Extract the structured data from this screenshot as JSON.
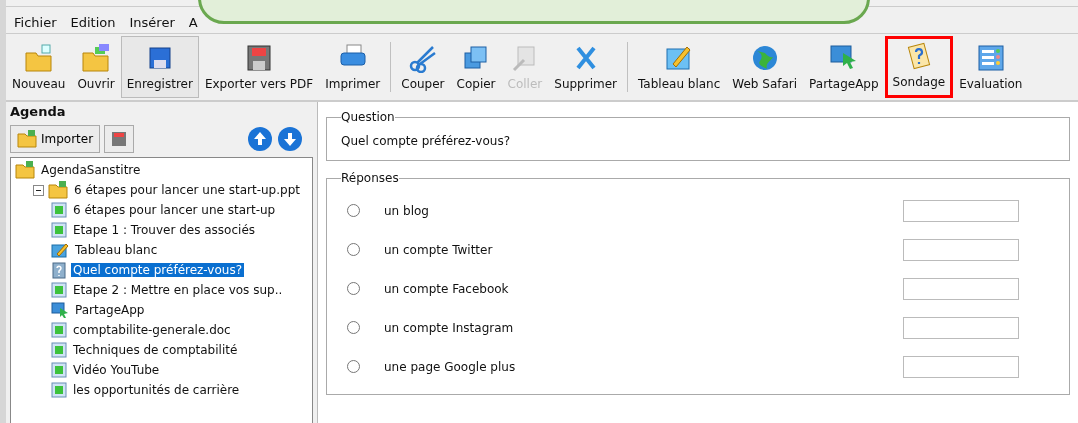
{
  "menu": [
    "Fichier",
    "Edition",
    "Insérer",
    "A"
  ],
  "toolbar": [
    {
      "kind": "button",
      "label": "Nouveau",
      "disabled": false,
      "pressed": false,
      "highlighted": false
    },
    {
      "kind": "button",
      "label": "Ouvrir",
      "disabled": false,
      "pressed": false,
      "highlighted": false
    },
    {
      "kind": "button",
      "label": "Enregistrer",
      "disabled": false,
      "pressed": true,
      "highlighted": false
    },
    {
      "kind": "button",
      "label": "Exporter vers PDF",
      "disabled": false,
      "pressed": false,
      "highlighted": false
    },
    {
      "kind": "button",
      "label": "Imprimer",
      "disabled": false,
      "pressed": false,
      "highlighted": false
    },
    {
      "kind": "separator"
    },
    {
      "kind": "button",
      "label": "Couper",
      "disabled": false,
      "pressed": false,
      "highlighted": false
    },
    {
      "kind": "button",
      "label": "Copier",
      "disabled": false,
      "pressed": false,
      "highlighted": false
    },
    {
      "kind": "button",
      "label": "Coller",
      "disabled": true,
      "pressed": false,
      "highlighted": false
    },
    {
      "kind": "button",
      "label": "Supprimer",
      "disabled": false,
      "pressed": false,
      "highlighted": false
    },
    {
      "kind": "separator"
    },
    {
      "kind": "button",
      "label": "Tableau blanc",
      "disabled": false,
      "pressed": false,
      "highlighted": false
    },
    {
      "kind": "button",
      "label": "Web Safari",
      "disabled": false,
      "pressed": false,
      "highlighted": false
    },
    {
      "kind": "button",
      "label": "PartageApp",
      "disabled": false,
      "pressed": false,
      "highlighted": false
    },
    {
      "kind": "button",
      "label": "Sondage",
      "disabled": false,
      "pressed": false,
      "highlighted": true
    },
    {
      "kind": "button",
      "label": "Evaluation",
      "disabled": false,
      "pressed": false,
      "highlighted": false
    }
  ],
  "agenda": {
    "title": "Agenda",
    "import_button": "Importer",
    "tree": [
      {
        "kind": "folder",
        "label": "AgendaSanstitre",
        "selected": false,
        "children": [
          {
            "kind": "folder",
            "label": "6 étapes pour lancer une start-up.ppt",
            "expanded": true,
            "selected": false,
            "children": [
              {
                "kind": "slide",
                "label": "6 étapes pour lancer une start-up",
                "selected": false
              },
              {
                "kind": "slide",
                "label": "Etape 1 : Trouver des associés",
                "selected": false
              },
              {
                "kind": "whiteboard",
                "label": "Tableau blanc",
                "selected": false
              },
              {
                "kind": "poll",
                "label": "Quel compte préférez-vous?",
                "selected": true
              },
              {
                "kind": "slide",
                "label": "Etape 2 : Mettre en place vos sup..",
                "selected": false
              },
              {
                "kind": "share",
                "label": "PartageApp",
                "selected": false
              },
              {
                "kind": "slide",
                "label": "comptabilite-generale.doc",
                "selected": false
              },
              {
                "kind": "slide",
                "label": "Techniques de comptabilité",
                "selected": false
              },
              {
                "kind": "slide",
                "label": "Vidéo YouTube",
                "selected": false
              },
              {
                "kind": "slide",
                "label": "les opportunités de carrière",
                "selected": false
              }
            ]
          }
        ]
      }
    ]
  },
  "question": {
    "legend": "Question",
    "text": "Quel compte préférez-vous?"
  },
  "answers": {
    "legend": "Réponses",
    "options": [
      {
        "label": "un blog",
        "selected": false
      },
      {
        "label": "un compte Twitter",
        "selected": false
      },
      {
        "label": "un compte Facebook",
        "selected": false
      },
      {
        "label": "un compte Instagram",
        "selected": false
      },
      {
        "label": "une page Google plus",
        "selected": false
      }
    ]
  }
}
